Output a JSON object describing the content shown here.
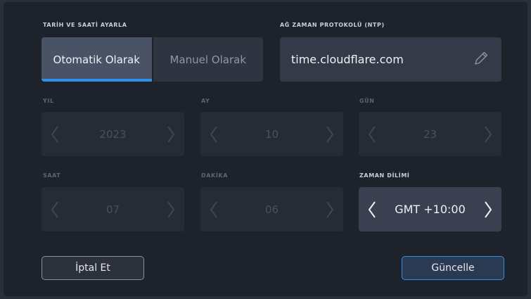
{
  "date_time": {
    "section_label": "TARİH VE SAATİ AYARLA",
    "modes": [
      {
        "label": "Otomatik Olarak",
        "active": true
      },
      {
        "label": "Manuel Olarak",
        "active": false
      }
    ]
  },
  "ntp": {
    "section_label": "AĞ ZAMAN PROTOKOLÜ (NTP)",
    "server": "time.cloudflare.com",
    "edit_icon": "pencil-icon"
  },
  "fields": {
    "year": {
      "label": "YIL",
      "value": "2023",
      "enabled": false
    },
    "month": {
      "label": "AY",
      "value": "10",
      "enabled": false
    },
    "day": {
      "label": "GÜN",
      "value": "23",
      "enabled": false
    },
    "hour": {
      "label": "SAAT",
      "value": "07",
      "enabled": false
    },
    "minute": {
      "label": "DAKİKA",
      "value": "06",
      "enabled": false
    },
    "timezone": {
      "label": "ZAMAN DİLİMİ",
      "value": "GMT +10:00",
      "enabled": true
    }
  },
  "buttons": {
    "cancel": "İptal Et",
    "update": "Güncelle"
  },
  "colors": {
    "accent": "#2f8ee8",
    "panel": "#1e222b",
    "active_segment": "#4a5366"
  }
}
